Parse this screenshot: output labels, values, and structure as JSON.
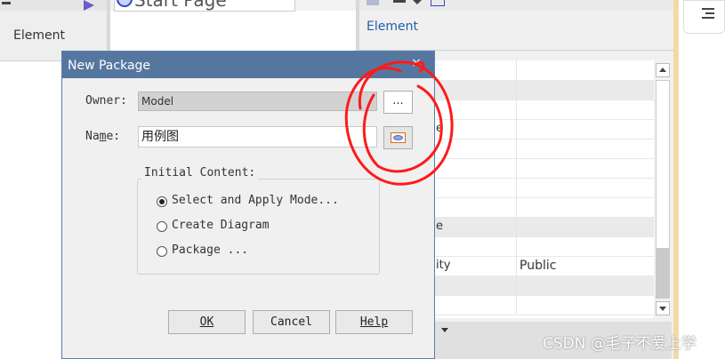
{
  "left_panel": {
    "tab": "Element"
  },
  "mid_panel": {
    "tab": "Start Page"
  },
  "right_panel": {
    "tab": "Element",
    "rows": [
      {
        "key": "",
        "value": "",
        "section": false
      },
      {
        "key": "",
        "value": "",
        "section": true
      },
      {
        "key": "",
        "value": "",
        "section": false
      },
      {
        "key": "e",
        "value": "",
        "section": false
      },
      {
        "key": "",
        "value": "",
        "section": false
      },
      {
        "key": "",
        "value": "",
        "section": false
      },
      {
        "key": "",
        "value": "",
        "section": false
      },
      {
        "key": "",
        "value": "",
        "section": false
      },
      {
        "key": "e",
        "value": "",
        "section": true
      },
      {
        "key": "",
        "value": "",
        "section": false
      },
      {
        "key": "ity",
        "value": "Public",
        "section": false
      },
      {
        "key": "",
        "value": "",
        "section": true
      },
      {
        "key": "",
        "value": "",
        "section": false
      }
    ]
  },
  "dialog": {
    "title": "New Package",
    "close": "×",
    "owner_label": "Owner:",
    "owner_value": "Model",
    "owner_browse": "...",
    "name_label_pre": "Na",
    "name_label_mn": "m",
    "name_label_post": "e:",
    "name_value": "用例图",
    "group_title": "Initial Content:",
    "options": [
      {
        "label": "Select and Apply Mode...",
        "selected": true
      },
      {
        "label": "Create Diagram",
        "selected": false
      },
      {
        "label": "Package ...",
        "selected": false
      }
    ],
    "ok": "OK",
    "cancel": "Cancel",
    "help": "Help"
  },
  "annotation_color": "#ff1a1a",
  "watermark": "CSDN @毛子不爱上学"
}
